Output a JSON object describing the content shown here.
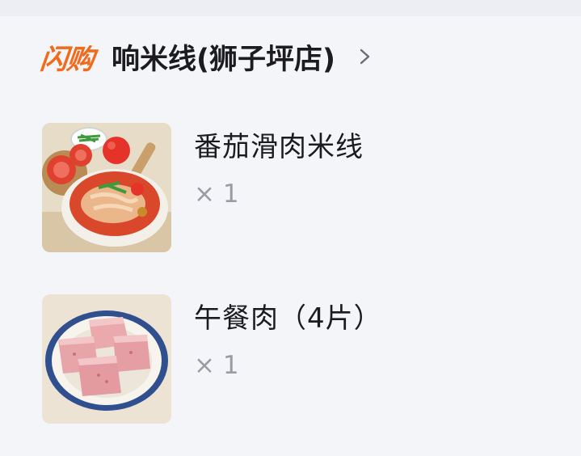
{
  "store": {
    "brand_label": "闪购",
    "name": "响米线(狮子坪店)"
  },
  "items": [
    {
      "name": "番茄滑肉米线",
      "quantity": "× 1",
      "image_icon": "tomato-meat-rice-noodle-photo"
    },
    {
      "name": "午餐肉（4片）",
      "quantity": "× 1",
      "image_icon": "luncheon-meat-photo"
    }
  ],
  "colors": {
    "brand_orange": "#f26a1b",
    "text_primary": "#1c1c1e",
    "text_secondary": "#9a9ca3",
    "background": "#f4f5f9"
  }
}
